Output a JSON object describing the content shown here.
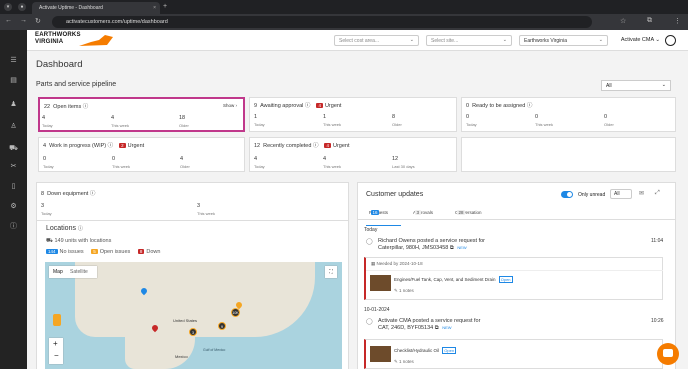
{
  "browser": {
    "tab_title": "Activate Uptime - Dashboard",
    "url": "activatecustomers.com/uptime/dashboard"
  },
  "header": {
    "logo": {
      "line1": "EARTHWORKS",
      "line2": "VIRGINIA"
    },
    "cost_area": {
      "placeholder": "Select cost area..."
    },
    "site": {
      "placeholder": "Select site..."
    },
    "org": {
      "value": "Earthworks Virginia"
    },
    "user": "Activate CMA"
  },
  "page": {
    "title": "Dashboard",
    "pipeline_title": "Parts and service pipeline",
    "filter": "All"
  },
  "pipeline": {
    "open_items": {
      "count": "22",
      "label": "Open items",
      "show": "Show",
      "stats": [
        {
          "value": "4",
          "label": "Today"
        },
        {
          "value": "4",
          "label": "This week"
        },
        {
          "value": "18",
          "label": "Older"
        }
      ]
    },
    "awaiting": {
      "count": "9",
      "label": "Awaiting approval",
      "badge_count": "4",
      "badge_label": "Urgent",
      "stats": [
        {
          "value": "1",
          "label": "Today"
        },
        {
          "value": "1",
          "label": "This week"
        },
        {
          "value": "8",
          "label": "Older"
        }
      ]
    },
    "ready": {
      "count": "0",
      "label": "Ready to be assigned",
      "stats": [
        {
          "value": "0",
          "label": "Today"
        },
        {
          "value": "0",
          "label": "This week"
        },
        {
          "value": "0",
          "label": "Older"
        }
      ]
    },
    "wip": {
      "count": "4",
      "label": "Work in progress (WIP)",
      "badge_count": "2",
      "badge_label": "Urgent",
      "stats": [
        {
          "value": "0",
          "label": "Today"
        },
        {
          "value": "0",
          "label": "This week"
        },
        {
          "value": "4",
          "label": "Older"
        }
      ]
    },
    "completed": {
      "count": "12",
      "label": "Recently completed",
      "badge_count": "4",
      "badge_label": "Urgent",
      "stats": [
        {
          "value": "4",
          "label": "Today"
        },
        {
          "value": "4",
          "label": "This week"
        },
        {
          "value": "12",
          "label": "Last 30 days"
        }
      ]
    }
  },
  "down_equipment": {
    "count": "8",
    "label": "Down equipment",
    "stats": [
      {
        "value": "3",
        "label": "Today"
      },
      {
        "value": "3",
        "label": "This week"
      }
    ]
  },
  "locations": {
    "title": "Locations",
    "units": "149 units with locations",
    "legend": [
      {
        "count": "144",
        "label": "No issues",
        "color": "#1e88e5"
      },
      {
        "count": "5",
        "label": "Open issues",
        "color": "#f5a623"
      },
      {
        "count": "8",
        "label": "Down",
        "color": "#c62828"
      }
    ],
    "map_tabs": [
      "Map",
      "Satellite"
    ],
    "map_labels": {
      "us": "United States",
      "mexico": "Mexico",
      "gulf": "Gulf of Mexico",
      "cluster1": "10K",
      "cluster2": "9",
      "cluster3": "3"
    }
  },
  "updates": {
    "title": "Customer updates",
    "only_unread": "Only unread",
    "filter": "All",
    "tabs": [
      {
        "label": "Requests",
        "count": "16"
      },
      {
        "label": "Approvals",
        "count": "3"
      },
      {
        "label": "Conversation",
        "count": "28"
      }
    ],
    "day1": "Today",
    "item1": {
      "author": "Richard Owens",
      "text": "posted a service request for",
      "target": "Caterpillar, 980H, JMS03458",
      "badge": "NEW",
      "time": "11:04",
      "needed": "Needed by 2024-10-18",
      "part": "Engines/Fuel Tank, Cap, Vent, and Sediment Drain",
      "status": "Open",
      "notes": "1 notes"
    },
    "day2": "10-01-2024",
    "item2": {
      "author": "Activate CMA",
      "text": "posted a service request for",
      "target": "CAT, 246D, BYF05134",
      "badge": "NEW",
      "time": "10:26",
      "part": "Checklist/Hydraulic Oil",
      "status": "Open",
      "notes": "1 notes"
    }
  }
}
